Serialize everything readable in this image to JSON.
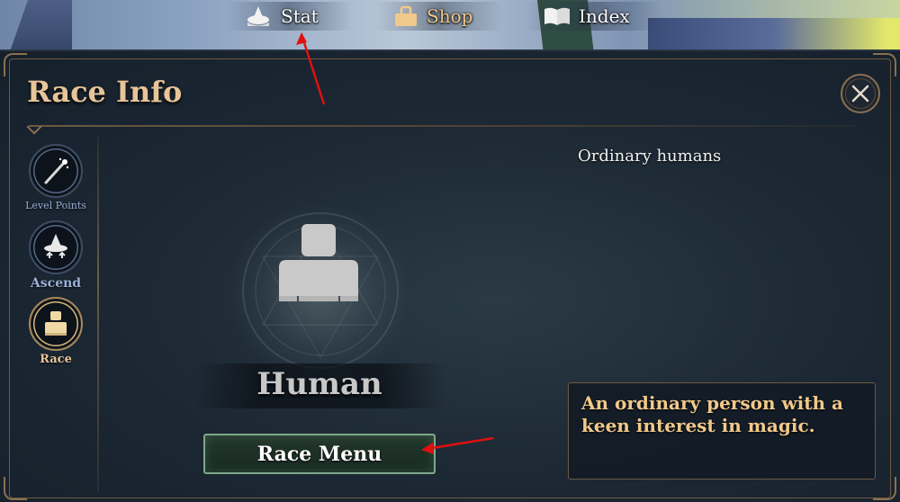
{
  "topbar": {
    "stat_label": "Stat",
    "shop_label": "Shop",
    "index_label": "Index"
  },
  "panel": {
    "title": "Race Info",
    "close_icon": "close-icon"
  },
  "sidebar": {
    "items": [
      {
        "label": "Level Points",
        "icon": "wand-icon"
      },
      {
        "label": "Ascend",
        "icon": "witch-hat-icon"
      },
      {
        "label": "Race",
        "icon": "character-icon",
        "active": true
      }
    ]
  },
  "race": {
    "name": "Human",
    "short_description": "Ordinary humans",
    "lore": "An ordinary person with a keen interest in magic.",
    "menu_button_label": "Race Menu"
  },
  "colors": {
    "title_gold": "#e8c49a",
    "frame_brown": "#6d5a43",
    "button_green": "#7da88a",
    "annotation_red": "#e01010"
  }
}
